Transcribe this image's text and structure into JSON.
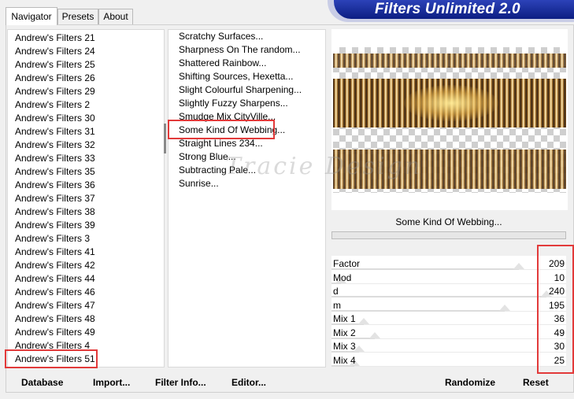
{
  "banner": {
    "title": "Filters Unlimited 2.0"
  },
  "tabs": [
    {
      "label": "Navigator",
      "active": true
    },
    {
      "label": "Presets",
      "active": false
    },
    {
      "label": "About",
      "active": false
    }
  ],
  "categories": [
    "Andrew's Filters 21",
    "Andrew's Filters 24",
    "Andrew's Filters 25",
    "Andrew's Filters 26",
    "Andrew's Filters 29",
    "Andrew's Filters 2",
    "Andrew's Filters 30",
    "Andrew's Filters 31",
    "Andrew's Filters 32",
    "Andrew's Filters 33",
    "Andrew's Filters 35",
    "Andrew's Filters 36",
    "Andrew's Filters 37",
    "Andrew's Filters 38",
    "Andrew's Filters 39",
    "Andrew's Filters 3",
    "Andrew's Filters 41",
    "Andrew's Filters 42",
    "Andrew's Filters 44",
    "Andrew's Filters 46",
    "Andrew's Filters 47",
    "Andrew's Filters 48",
    "Andrew's Filters 49",
    "Andrew's Filters 4",
    "Andrew's Filters 51"
  ],
  "filters": [
    "Scratchy Surfaces...",
    "Sharpness On The random...",
    "Shattered Rainbow...",
    "Shifting Sources, Hexetta...",
    "Slight Colourful Sharpening...",
    "Slightly Fuzzy Sharpens...",
    "Smudge Mix CityVille...",
    "Some Kind Of Webbing...",
    "Straight Lines 234...",
    "Strong Blue...",
    "Subtracting Pale...",
    "Sunrise..."
  ],
  "selected_category": "Andrew's Filters 51",
  "selected_filter": "Some Kind Of Webbing...",
  "preview": {
    "watermark": "Tracie Design",
    "filter_name": "Some Kind Of Webbing..."
  },
  "parameters": [
    {
      "label": "Factor",
      "value": "209",
      "level": 0.82
    },
    {
      "label": "Mod",
      "value": "10",
      "level": 0.04
    },
    {
      "label": "d",
      "value": "240",
      "level": 0.94
    },
    {
      "label": "m",
      "value": "195",
      "level": 0.76
    },
    {
      "label": "Mix 1",
      "value": "36",
      "level": 0.14
    },
    {
      "label": "Mix 2",
      "value": "49",
      "level": 0.19
    },
    {
      "label": "Mix 3",
      "value": "30",
      "level": 0.12
    },
    {
      "label": "Mix 4",
      "value": "25",
      "level": 0.1
    }
  ],
  "buttons": {
    "database": "Database",
    "import": "Import...",
    "filter_info": "Filter Info...",
    "editor": "Editor...",
    "randomize": "Randomize",
    "reset": "Reset"
  },
  "colors": {
    "banner_blue": "#0c1e82",
    "highlight_red": "#e23a3a"
  }
}
